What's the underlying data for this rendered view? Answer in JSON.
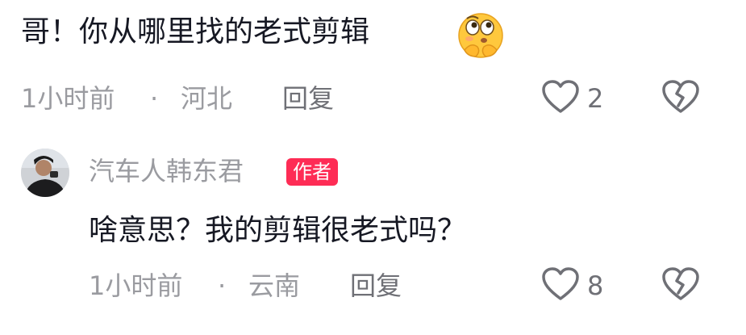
{
  "comment1": {
    "text": "哥！你从哪里找的老式剪辑",
    "emoji": "thinking-face-emoji",
    "time": "1小时前",
    "dot": "·",
    "location": "河北",
    "reply_label": "回复",
    "like_count": "2"
  },
  "comment2": {
    "author": "汽车人韩东君",
    "badge": "作者",
    "text": "啥意思？我的剪辑很老式吗？",
    "time": "1小时前",
    "dot": "·",
    "location": "云南",
    "reply_label": "回复",
    "like_count": "8"
  },
  "colors": {
    "badge": "#fe2c55",
    "meta": "#9a9ba0",
    "text": "#161823"
  }
}
